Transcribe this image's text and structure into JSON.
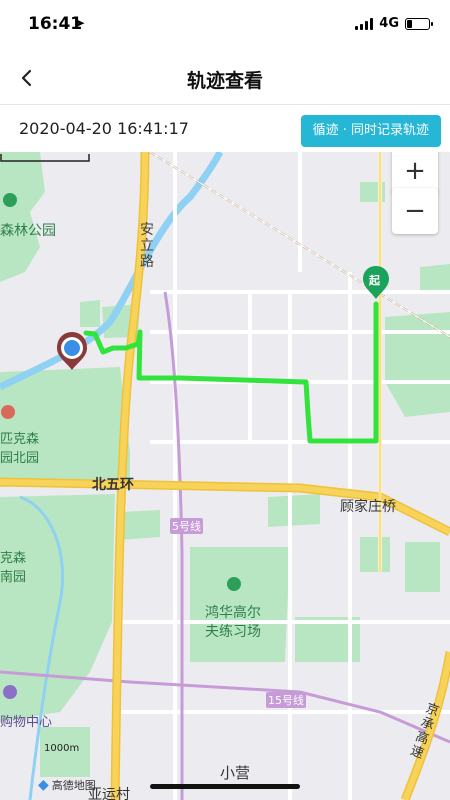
{
  "status": {
    "time": "16:41",
    "network": "4G",
    "battery_percent": 25,
    "colors": {
      "text": "#000000"
    }
  },
  "nav": {
    "back_icon": "chevron-left-icon",
    "title": "轨迹查看"
  },
  "info": {
    "datetime": "2020-04-20 16:41:17",
    "record_button": "循迹 · 同时记录轨迹",
    "colors": {
      "button": "#26b6d6"
    }
  },
  "map": {
    "zoom_in": "+",
    "zoom_out": "−",
    "labels": {
      "park_north": "森林公园",
      "road_anli": "安立路",
      "park_left_1": "匹克森",
      "park_left_2": "园北园",
      "ring_road": "北五环",
      "village": "顾家庄桥",
      "line5": "5号线",
      "park_left_3": "克森",
      "park_left_4": "南园",
      "golf_1": "鸿华高尔",
      "golf_2": "夫练习场",
      "line15": "15号线",
      "mall": "购物中心",
      "highway": "京承高速",
      "xiaoying": "小营",
      "yayuncun": "亚运村"
    },
    "start_marker": "起",
    "scale": "1000m",
    "logo": "高德地图",
    "colors": {
      "background": "#ececf0",
      "green_area": "#b9e6c2",
      "track": "#33e33d",
      "main_road": "#f7d35a",
      "river": "#8fd1f3",
      "start_marker": "#1aa35a",
      "current_location": "#3a8ee6"
    }
  }
}
